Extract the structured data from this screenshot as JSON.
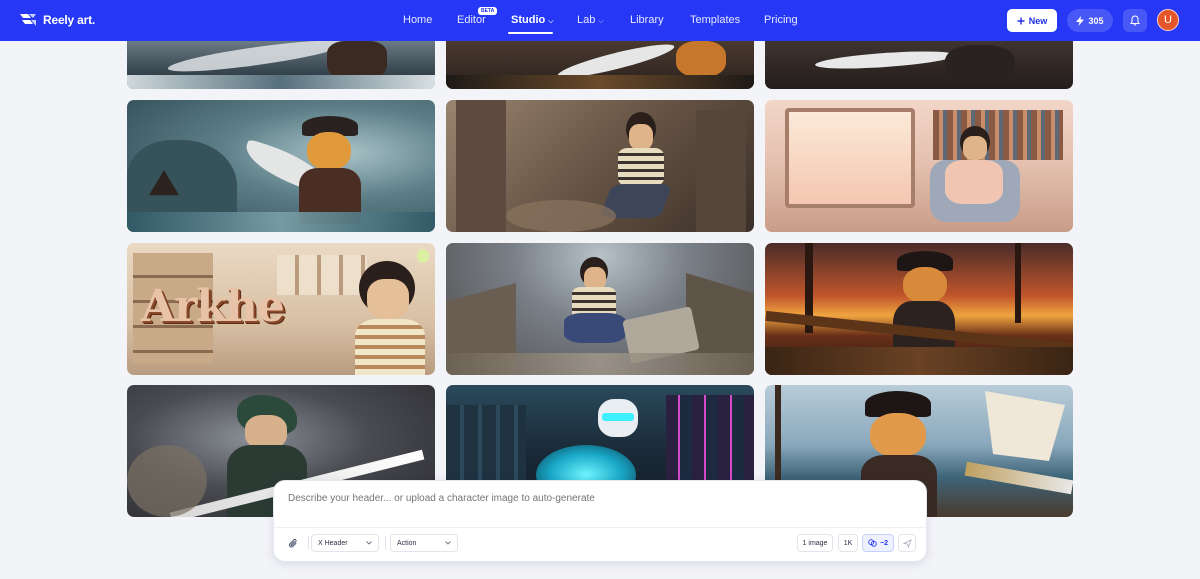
{
  "brand": {
    "name": "Reely art."
  },
  "nav": {
    "items": [
      {
        "label": "Home"
      },
      {
        "label": "Editor",
        "badge": "BETA"
      },
      {
        "label": "Studio",
        "active": true,
        "dropdown": true
      },
      {
        "label": "Lab",
        "dropdown": true
      },
      {
        "label": "Library"
      },
      {
        "label": "Templates"
      },
      {
        "label": "Pricing"
      }
    ],
    "new_label": "New",
    "credits": "305",
    "avatar_initial": "U",
    "icons": [
      "plus-icon",
      "lightning-icon",
      "bell-icon"
    ]
  },
  "gallery": {
    "items": [
      {
        "subject": "pirate cat sword slash, stormy sea (cropped)"
      },
      {
        "subject": "pirate cat sword slash, ship deck (cropped)"
      },
      {
        "subject": "pirate cat sword slash, dark cabin (cropped)"
      },
      {
        "subject": "pirate cat swinging sword in storm"
      },
      {
        "subject": "bearded man running through ruins"
      },
      {
        "subject": "bearded man relaxing in cozy room"
      },
      {
        "subject": "Arkhe lettering with bearded man",
        "text": "Arkhe"
      },
      {
        "subject": "bearded man leaping over rubble"
      },
      {
        "subject": "pirate cat with drink at sunset"
      },
      {
        "subject": "green-haired swordsman"
      },
      {
        "subject": "cyber cat in neon city"
      },
      {
        "subject": "pirate cat on ship deck"
      }
    ]
  },
  "prompt": {
    "placeholder": "Describe your header... or upload a character image to auto-generate",
    "format_select": "X Header",
    "style_select": "Action",
    "count_label": "1 image",
    "resolution_label": "1K",
    "cost_label": "−2"
  },
  "colors": {
    "nav_bg": "#2638f5",
    "accent": "#2638f5",
    "avatar": "#e4552a"
  }
}
